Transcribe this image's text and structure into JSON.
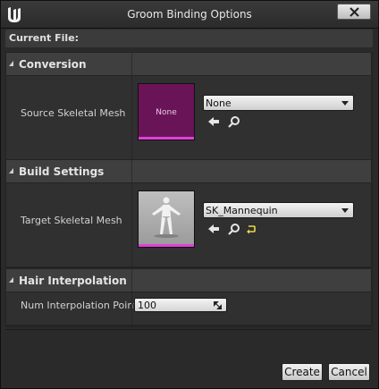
{
  "window": {
    "title": "Groom Binding Options"
  },
  "current_file": {
    "label": "Current File:"
  },
  "sections": {
    "conversion": {
      "label": "Conversion",
      "source_mesh": {
        "label": "Source Skeletal Mesh",
        "thumbnail_text": "None",
        "value": "None"
      }
    },
    "build": {
      "label": "Build Settings",
      "target_mesh": {
        "label": "Target Skeletal Mesh",
        "value": "SK_Mannequin"
      }
    },
    "interpolation": {
      "label": "Hair Interpolation",
      "points": {
        "label": "Num Interpolation Points",
        "value": "100"
      }
    }
  },
  "footer": {
    "create_label": "Create",
    "cancel_label": "Cancel"
  },
  "colors": {
    "accent_magenta": "#e040d8",
    "empty_thumbnail": "#6a1458",
    "reset_arrow": "#e8d84a"
  }
}
